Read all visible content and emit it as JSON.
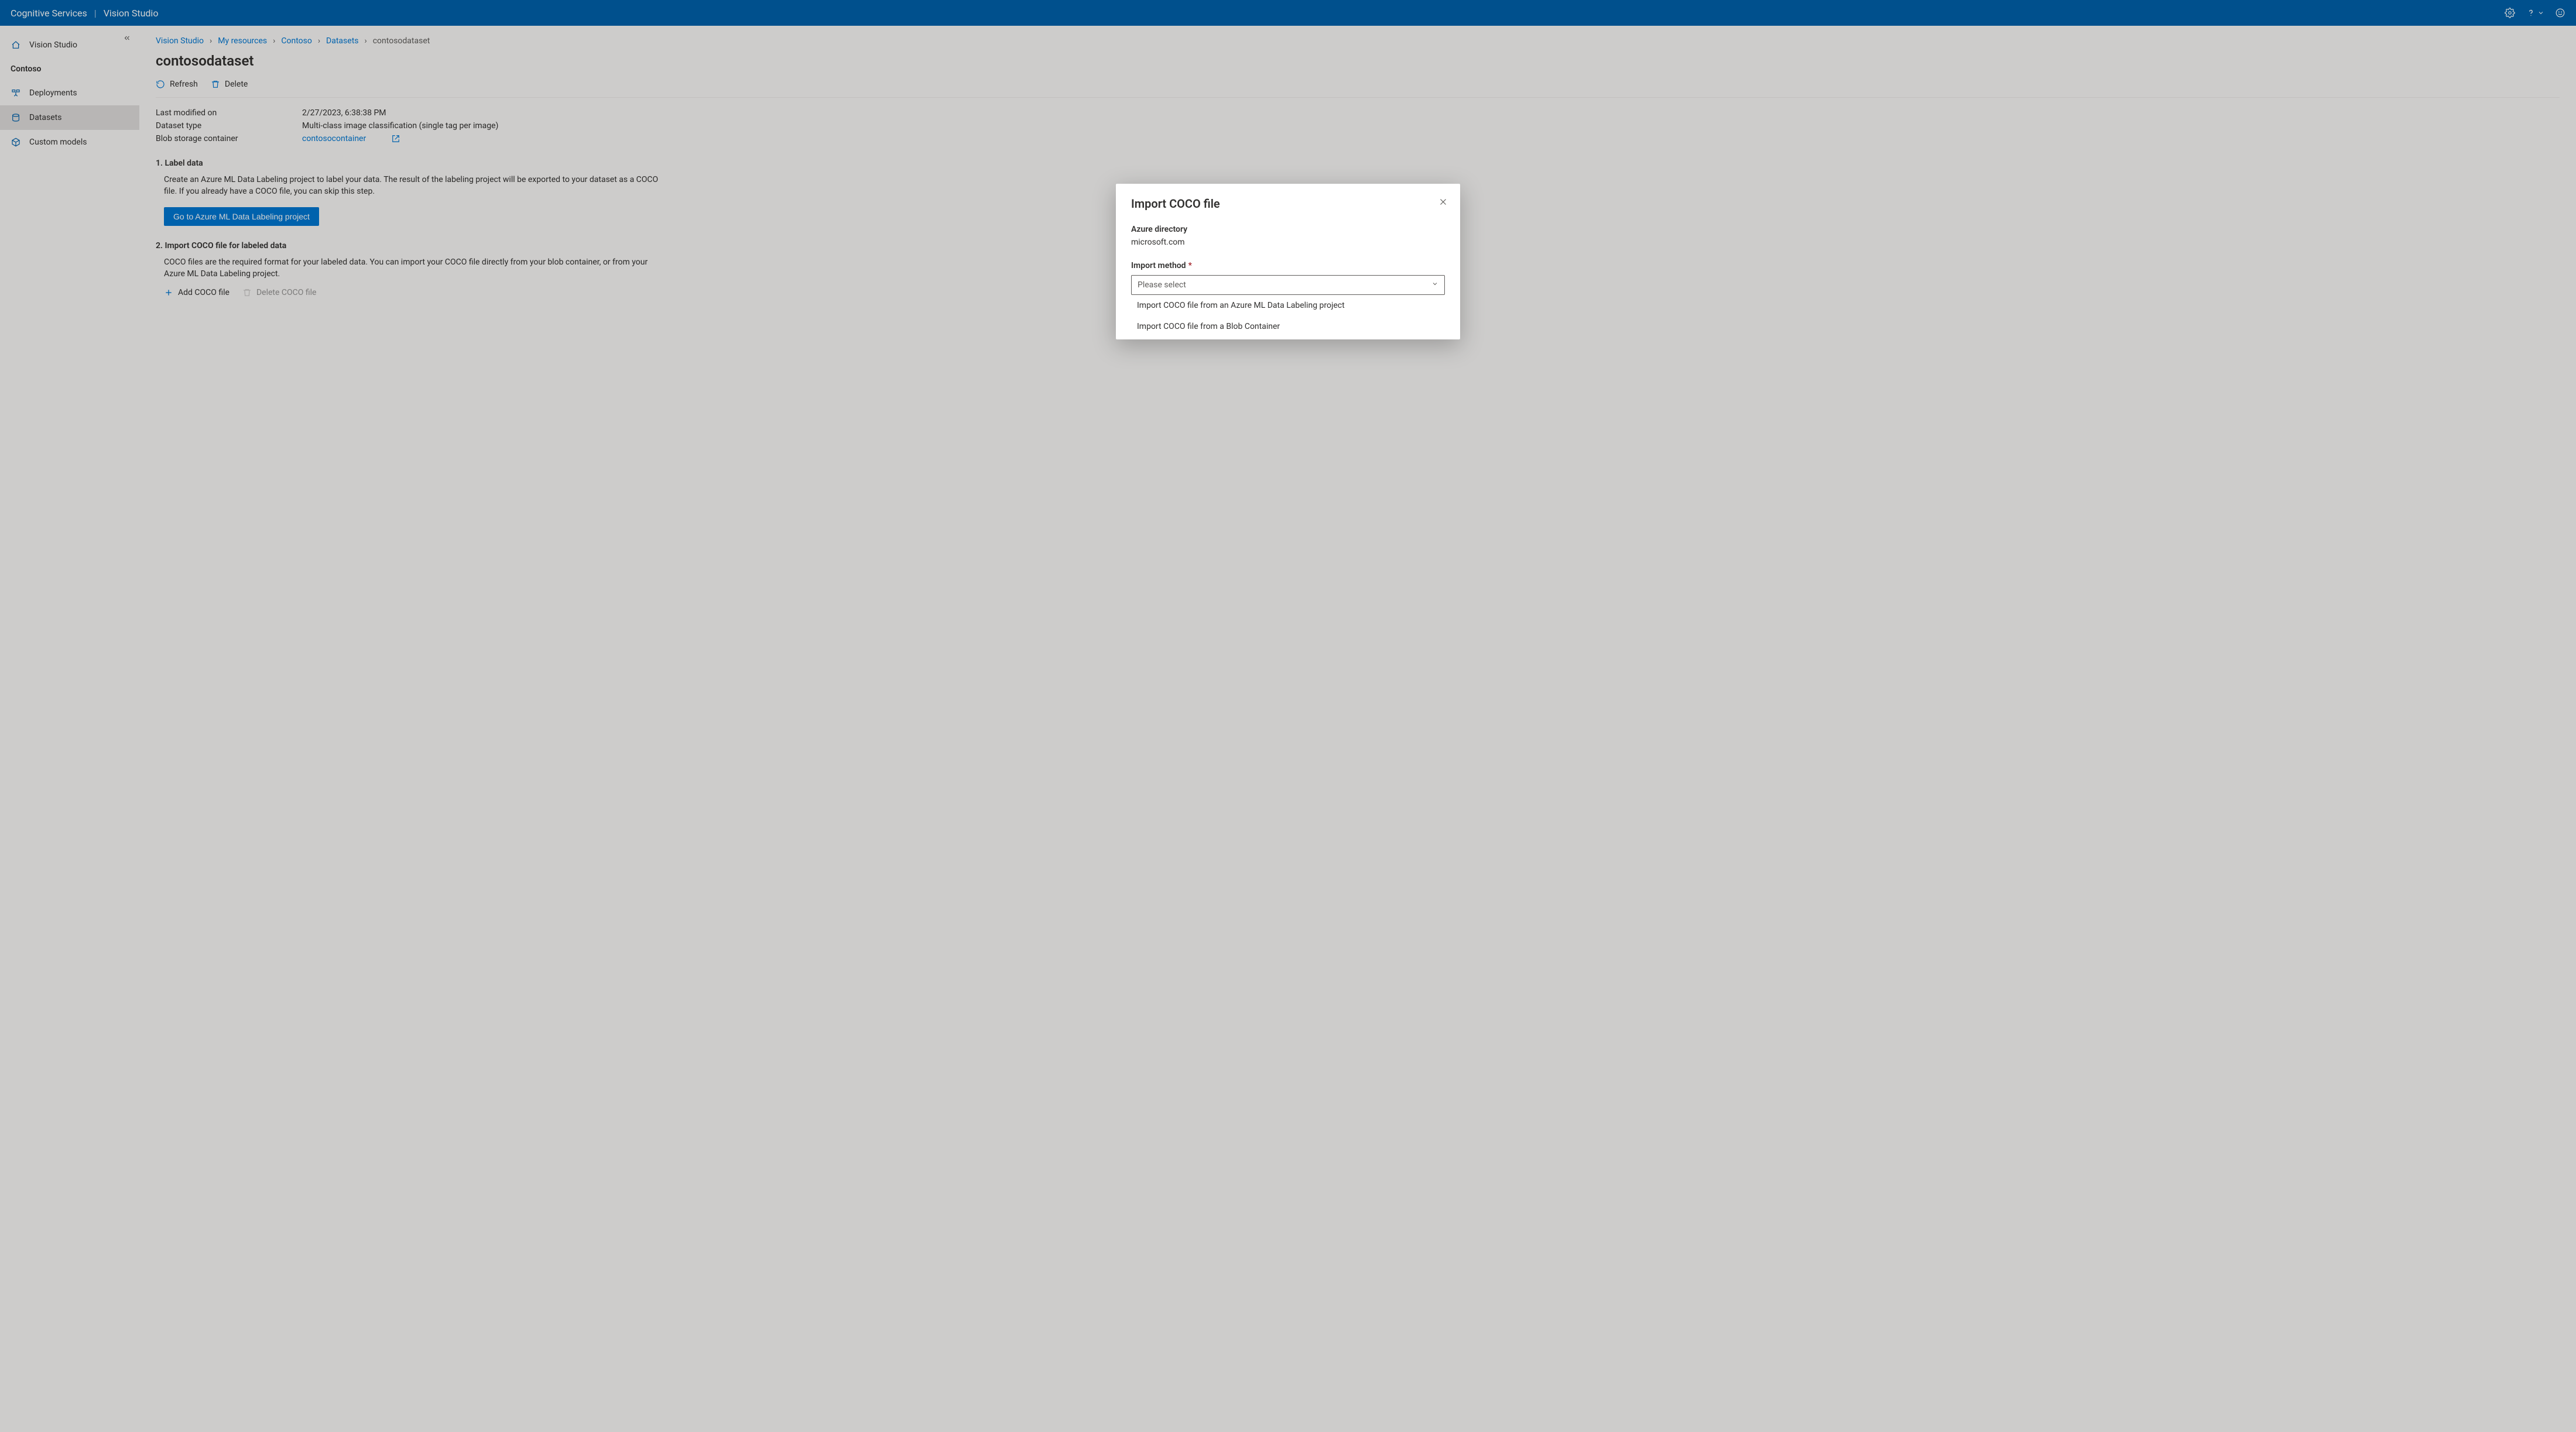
{
  "header": {
    "service": "Cognitive Services",
    "product": "Vision Studio"
  },
  "sidebar": {
    "home": "Vision Studio",
    "project": "Contoso",
    "items": {
      "deployments": "Deployments",
      "datasets": "Datasets",
      "custom_models": "Custom models"
    }
  },
  "breadcrumb": {
    "c0": "Vision Studio",
    "c1": "My resources",
    "c2": "Contoso",
    "c3": "Datasets",
    "c4": "contosodataset"
  },
  "page": {
    "title": "contosodataset",
    "actions": {
      "refresh": "Refresh",
      "delete": "Delete"
    },
    "props": {
      "last_modified_label": "Last modified on",
      "last_modified_value": "2/27/2023, 6:38:38 PM",
      "dataset_type_label": "Dataset type",
      "dataset_type_value": "Multi-class image classification (single tag per image)",
      "blob_label": "Blob storage container",
      "blob_value": "contosocontainer"
    },
    "section1": {
      "heading": "1. Label data",
      "body": "Create an Azure ML Data Labeling project to label your data. The result of the labeling project will be exported to your dataset as a COCO file. If you already have a COCO file, you can skip this step.",
      "button": "Go to Azure ML Data Labeling project"
    },
    "section2": {
      "heading": "2. Import COCO file for labeled data",
      "body": "COCO files are the required format for your labeled data. You can import your COCO file directly from your blob container, or from your Azure ML Data Labeling project.",
      "add": "Add COCO file",
      "delete": "Delete COCO file"
    }
  },
  "modal": {
    "title": "Import COCO file",
    "azure_dir_label": "Azure directory",
    "azure_dir_value": "microsoft.com",
    "import_method_label": "Import method",
    "select_placeholder": "Please select",
    "options": {
      "o0": "Import COCO file from an Azure ML Data Labeling project",
      "o1": "Import COCO file from a Blob Container"
    }
  }
}
